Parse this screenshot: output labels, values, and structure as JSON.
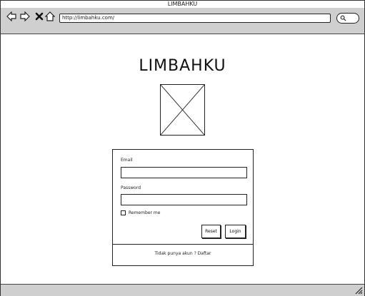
{
  "window": {
    "title": "LIMBAHKU"
  },
  "toolbar": {
    "url": "http://limbahku.com/",
    "icons": [
      "back-icon",
      "forward-icon",
      "close-icon",
      "home-icon",
      "search-icon",
      "resize-icon"
    ]
  },
  "page": {
    "app_title": "LIMBAHKU",
    "logo": "image-placeholder"
  },
  "login_form": {
    "email_label": "Email",
    "email_value": "",
    "password_label": "Password",
    "password_value": "",
    "remember_label": "Remember me",
    "remember_checked": false,
    "reset_label": "Reset",
    "login_label": "Login",
    "footer_text": "Tidak punya akun ? Daftar"
  }
}
